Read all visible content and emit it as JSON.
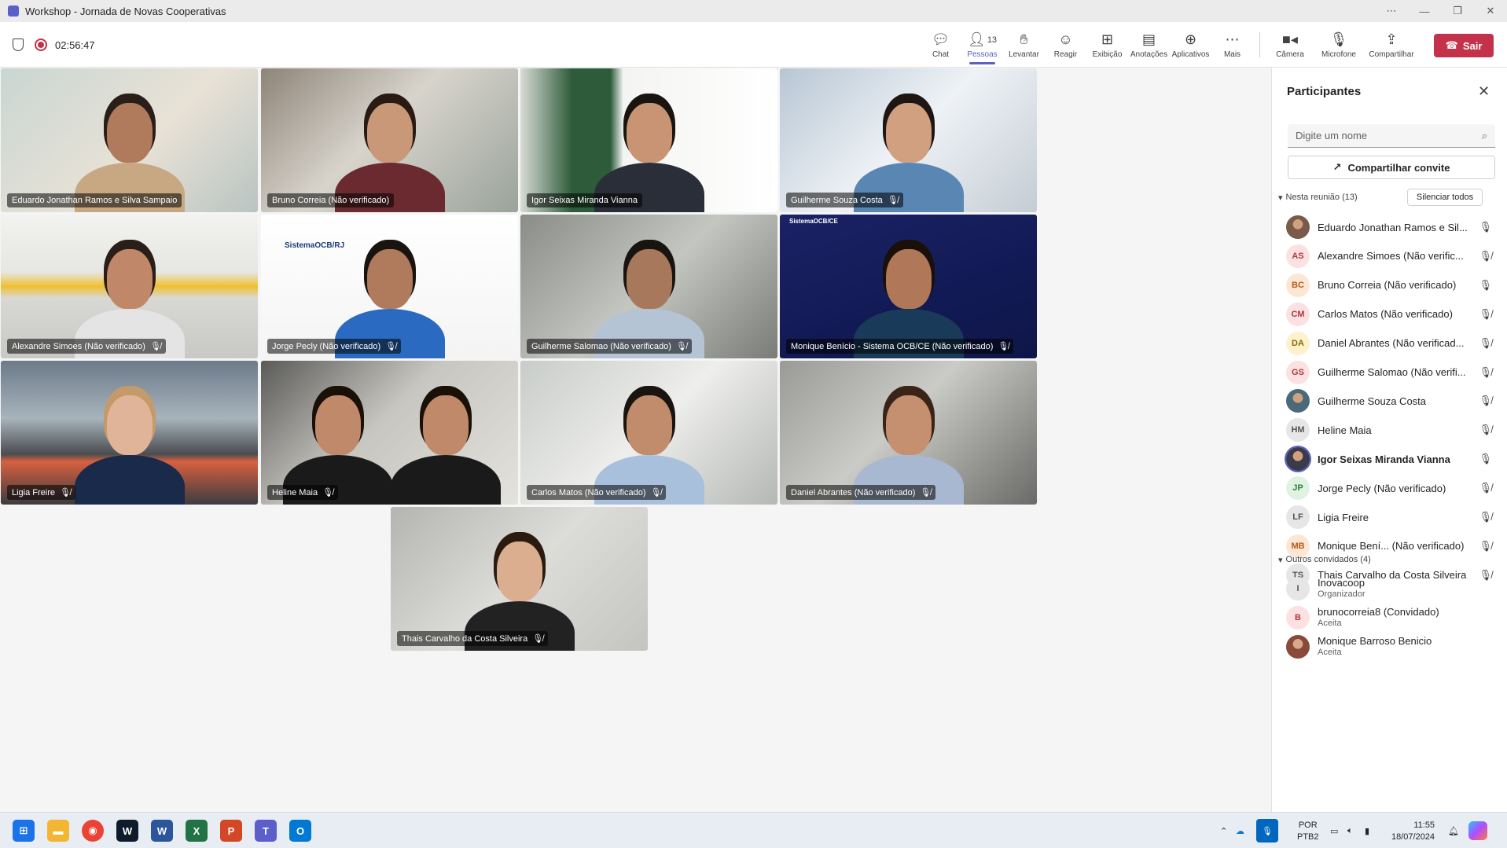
{
  "window": {
    "title": "Workshop - Jornada de Novas Cooperativas"
  },
  "recording": {
    "timer": "02:56:47"
  },
  "toolbar": {
    "chat": "Chat",
    "people": "Pessoas",
    "people_count": "13",
    "raise": "Levantar",
    "react": "Reagir",
    "view": "Exibição",
    "notes": "Anotações",
    "apps": "Aplicativos",
    "more": "Mais",
    "camera": "Câmera",
    "mic": "Microfone",
    "share": "Compartilhar",
    "leave": "Sair"
  },
  "tiles": [
    {
      "name": "Eduardo Jonathan Ramos e Silva Sampaio",
      "muted": false
    },
    {
      "name": "Bruno Correia (Não verificado)",
      "muted": false
    },
    {
      "name": "Igor Seixas Miranda Vianna",
      "muted": false,
      "speaking": true
    },
    {
      "name": "Guilherme Souza Costa",
      "muted": true
    },
    {
      "name": "Alexandre Simoes (Não verificado)",
      "muted": true
    },
    {
      "name": "Jorge Pecly (Não verificado)",
      "muted": true,
      "overlay": "SistemaOCB/RJ"
    },
    {
      "name": "Guilherme Salomao (Não verificado)",
      "muted": true
    },
    {
      "name": "Monique Benício - Sistema OCB/CE (Não verificado)",
      "muted": true,
      "overlay": "SistemaOCB/CE"
    },
    {
      "name": "Ligia Freire",
      "muted": true
    },
    {
      "name": "Heline Maia",
      "muted": true
    },
    {
      "name": "Carlos Matos (Não verificado)",
      "muted": true
    },
    {
      "name": "Daniel Abrantes (Não verificado)",
      "muted": true
    },
    {
      "name": "Thais Carvalho da Costa Silveira",
      "muted": true
    }
  ],
  "panel": {
    "title": "Participantes",
    "search_placeholder": "Digite um nome",
    "share_invite": "Compartilhar convite",
    "in_meeting": "Nesta reunião (13)",
    "mute_all": "Silenciar todos",
    "participants": [
      {
        "initials": "",
        "name": "Eduardo Jonathan Ramos e Sil...",
        "muted": false,
        "color": "#7a5a48",
        "photo": true
      },
      {
        "initials": "AS",
        "name": "Alexandre Simoes (Não verific...",
        "muted": true,
        "color": "#fbe1e1",
        "fg": "#b03a3a"
      },
      {
        "initials": "BC",
        "name": "Bruno Correia (Não verificado)",
        "muted": false,
        "color": "#fde7d4",
        "fg": "#b25a1a"
      },
      {
        "initials": "CM",
        "name": "Carlos Matos (Não verificado)",
        "muted": true,
        "color": "#fbe1e1",
        "fg": "#b03a3a"
      },
      {
        "initials": "DA",
        "name": "Daniel Abrantes (Não verificad...",
        "muted": true,
        "color": "#fdf2cc",
        "fg": "#8a6a0a"
      },
      {
        "initials": "GS",
        "name": "Guilherme Salomao (Não verifi...",
        "muted": true,
        "color": "#fbe1e1",
        "fg": "#b03a3a"
      },
      {
        "initials": "",
        "name": "Guilherme Souza Costa",
        "muted": true,
        "color": "#4a6a7a",
        "photo": true
      },
      {
        "initials": "HM",
        "name": "Heline Maia",
        "muted": true,
        "color": "#e6e6e6",
        "fg": "#555555"
      },
      {
        "initials": "",
        "name": "Igor Seixas Miranda Vianna",
        "muted": false,
        "color": "#3a3a4a",
        "photo": true,
        "bold": true
      },
      {
        "initials": "JP",
        "name": "Jorge Pecly (Não verificado)",
        "muted": true,
        "color": "#e0f3e3",
        "fg": "#2e7d3a"
      },
      {
        "initials": "LF",
        "name": "Ligia Freire",
        "muted": true,
        "color": "#e6e6e6",
        "fg": "#555555"
      },
      {
        "initials": "MB",
        "name": "Monique Bení... (Não verificado)",
        "muted": true,
        "color": "#fde7d4",
        "fg": "#b25a1a"
      },
      {
        "initials": "TS",
        "name": "Thais Carvalho da Costa Silveira",
        "muted": true,
        "color": "#e6e6e6",
        "fg": "#555555"
      }
    ],
    "others_head": "Outros convidados (4)",
    "others": [
      {
        "initials": "I",
        "name": "Inovacoop",
        "sub": "Organizador",
        "color": "#e6e6e6",
        "fg": "#555555"
      },
      {
        "initials": "B",
        "name": "brunocorreia8 (Convidado)",
        "sub": "Aceita",
        "color": "#fbe1e1",
        "fg": "#b03a3a"
      },
      {
        "initials": "",
        "name": "Monique Barroso Benicio",
        "sub": "Aceita",
        "color": "#8a4a3a",
        "photo": true
      }
    ]
  },
  "taskbar": {
    "lang_1": "POR",
    "lang_2": "PTB2",
    "time": "11:55",
    "date": "18/07/2024"
  }
}
